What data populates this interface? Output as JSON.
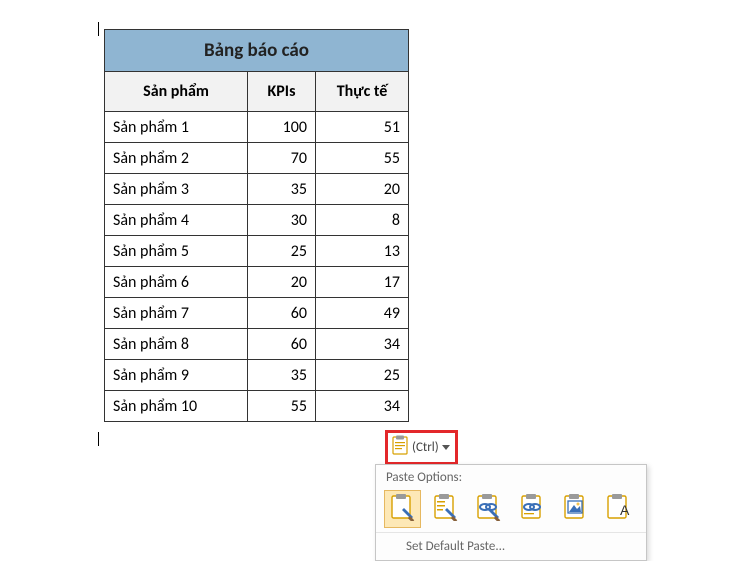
{
  "table": {
    "title": "Bảng báo cáo",
    "headers": {
      "product": "Sản phẩm",
      "kpi": "KPIs",
      "actual": "Thực tế"
    },
    "rows": [
      {
        "product": "Sản phẩm 1",
        "kpi": 100,
        "actual": 51
      },
      {
        "product": "Sản phẩm 2",
        "kpi": 70,
        "actual": 55
      },
      {
        "product": "Sản phẩm 3",
        "kpi": 35,
        "actual": 20
      },
      {
        "product": "Sản phẩm 4",
        "kpi": 30,
        "actual": 8
      },
      {
        "product": "Sản phẩm 5",
        "kpi": 25,
        "actual": 13
      },
      {
        "product": "Sản phẩm 6",
        "kpi": 20,
        "actual": 17
      },
      {
        "product": "Sản phẩm 7",
        "kpi": 60,
        "actual": 49
      },
      {
        "product": "Sản phẩm 8",
        "kpi": 60,
        "actual": 34
      },
      {
        "product": "Sản phẩm 9",
        "kpi": 35,
        "actual": 25
      },
      {
        "product": "Sản phẩm 10",
        "kpi": 55,
        "actual": 34
      }
    ]
  },
  "paste": {
    "ctrl_label": "(Ctrl)",
    "section_title": "Paste Options:",
    "options": [
      {
        "name": "keep-source-formatting",
        "selected": true
      },
      {
        "name": "merge-formatting",
        "selected": false
      },
      {
        "name": "link-keep-source-formatting",
        "selected": false
      },
      {
        "name": "link-merge-formatting",
        "selected": false
      },
      {
        "name": "picture",
        "selected": false
      },
      {
        "name": "keep-text-only",
        "selected": false
      }
    ],
    "footer": "Set Default Paste..."
  }
}
